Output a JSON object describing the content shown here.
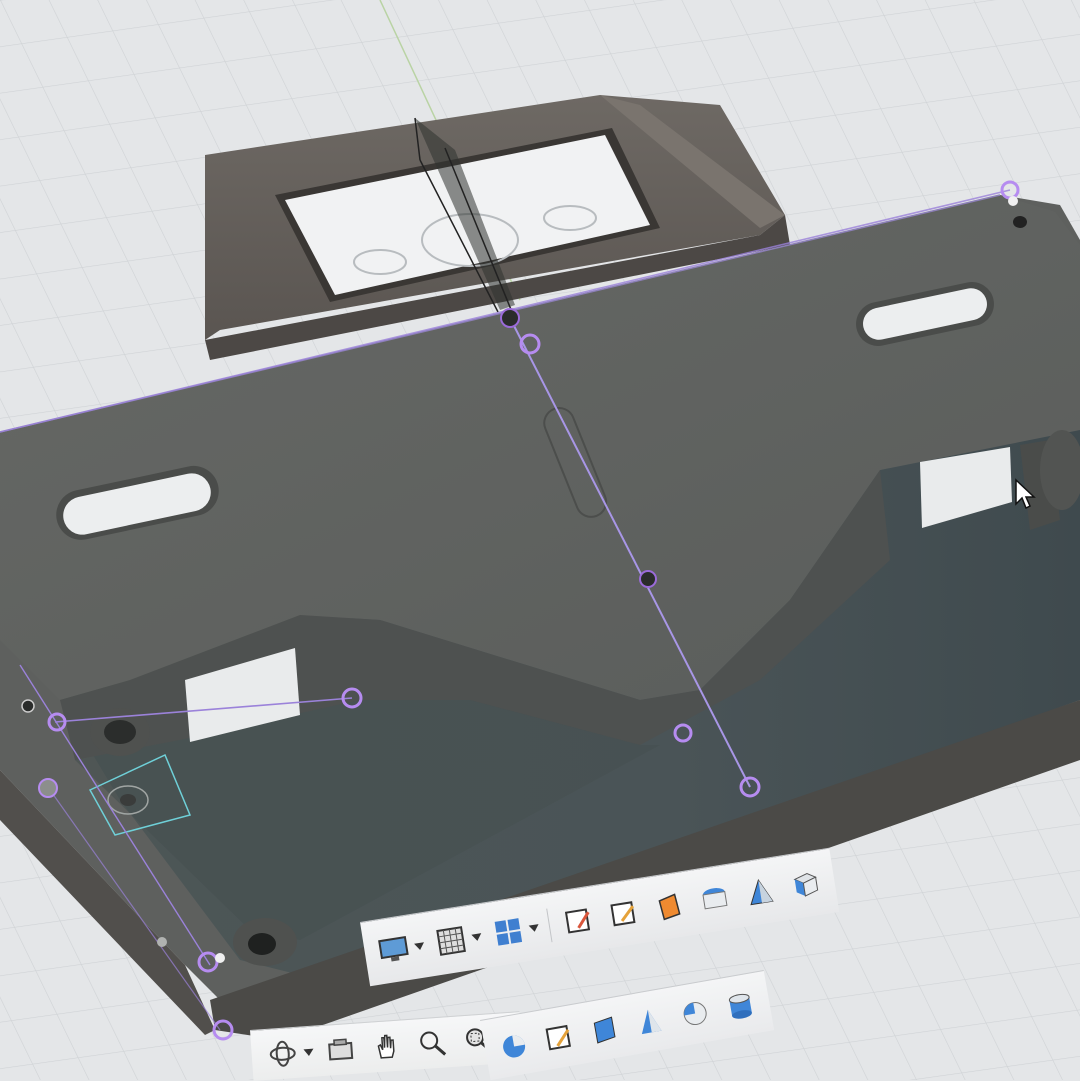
{
  "app": {
    "name": "",
    "accent_color": "#9b6bd9",
    "viewport_background": "#e4e6e8",
    "model_color": "#5f615f"
  },
  "viewport": {
    "grid": true,
    "cursor": "arrow-cursor",
    "sketch_line_color": "#a88be0"
  },
  "toolbar": {
    "navigation": [
      {
        "name": "orbit-icon",
        "dropdown": true
      },
      {
        "name": "look-at-icon",
        "dropdown": false
      },
      {
        "name": "pan-icon",
        "dropdown": false
      },
      {
        "name": "zoom-icon",
        "dropdown": false
      },
      {
        "name": "fit-icon",
        "dropdown": true
      },
      {
        "name": "display-settings-icon",
        "dropdown": true
      },
      {
        "name": "grid-snaps-icon",
        "dropdown": true
      },
      {
        "name": "viewports-icon",
        "dropdown": true
      }
    ],
    "selection_filters": [
      {
        "name": "sketch-filter-icon"
      },
      {
        "name": "body-filter-icon"
      },
      {
        "name": "cone-filter-icon"
      },
      {
        "name": "sphere-filter-icon"
      },
      {
        "name": "sketch-edit-filter-icon"
      },
      {
        "name": "surface-filter-icon"
      },
      {
        "name": "sketch-dim-filter-icon"
      },
      {
        "name": "profile-filter-icon"
      },
      {
        "name": "face-filter-icon"
      },
      {
        "name": "cylinder-filter-icon"
      },
      {
        "name": "prism-filter-icon"
      },
      {
        "name": "box-filter-icon"
      }
    ]
  }
}
